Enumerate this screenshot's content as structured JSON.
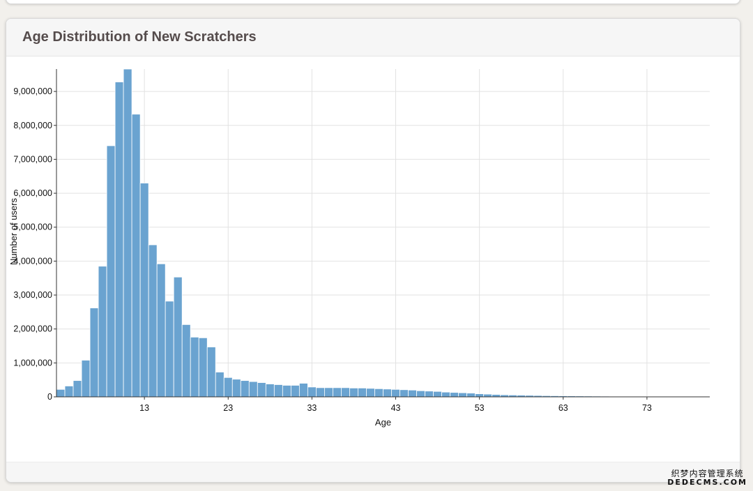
{
  "card": {
    "title": "Age Distribution of New Scratchers"
  },
  "chart_data": {
    "type": "bar",
    "title": "Age Distribution of New Scratchers",
    "xlabel": "Age",
    "ylabel": "Number of users",
    "x": [
      3,
      4,
      5,
      6,
      7,
      8,
      9,
      10,
      11,
      12,
      13,
      14,
      15,
      16,
      17,
      18,
      19,
      20,
      21,
      22,
      23,
      24,
      25,
      26,
      27,
      28,
      29,
      30,
      31,
      32,
      33,
      34,
      35,
      36,
      37,
      38,
      39,
      40,
      41,
      42,
      43,
      44,
      45,
      46,
      47,
      48,
      49,
      50,
      51,
      52,
      53,
      54,
      55,
      56,
      57,
      58,
      59,
      60,
      61,
      62,
      63,
      64,
      65,
      66,
      67,
      68,
      69,
      70,
      71,
      72,
      73,
      74,
      75,
      76,
      77,
      78,
      79,
      80
    ],
    "values": [
      220000,
      320000,
      480000,
      1080000,
      2620000,
      3850000,
      7400000,
      9280000,
      9660000,
      8330000,
      6300000,
      4480000,
      3920000,
      2820000,
      3530000,
      2130000,
      1760000,
      1740000,
      1470000,
      730000,
      570000,
      520000,
      480000,
      450000,
      420000,
      380000,
      360000,
      340000,
      340000,
      400000,
      290000,
      270000,
      270000,
      270000,
      270000,
      260000,
      260000,
      250000,
      240000,
      230000,
      220000,
      210000,
      200000,
      180000,
      170000,
      160000,
      140000,
      130000,
      120000,
      110000,
      90000,
      80000,
      70000,
      60000,
      55000,
      50000,
      45000,
      40000,
      35000,
      32000,
      30000,
      28000,
      26000,
      24000,
      22000,
      20000,
      18000,
      16000,
      15000,
      14000,
      13000,
      12000,
      11000,
      10000,
      9000,
      8000,
      7000,
      6000
    ],
    "xticks": [
      13,
      23,
      33,
      43,
      53,
      63,
      73
    ],
    "yticks": [
      0,
      1000000,
      2000000,
      3000000,
      4000000,
      5000000,
      6000000,
      7000000,
      8000000,
      9000000
    ],
    "xlim": [
      2.5,
      80.5
    ],
    "ylim": [
      0,
      9660000
    ],
    "grid": true,
    "colors": {
      "bar": "#6aa3d0",
      "bar_stroke": "#ffffff",
      "grid": "#e2e2e2"
    }
  },
  "watermark": {
    "cn": "织梦内容管理系统",
    "en": "DEDECMS.COM"
  }
}
